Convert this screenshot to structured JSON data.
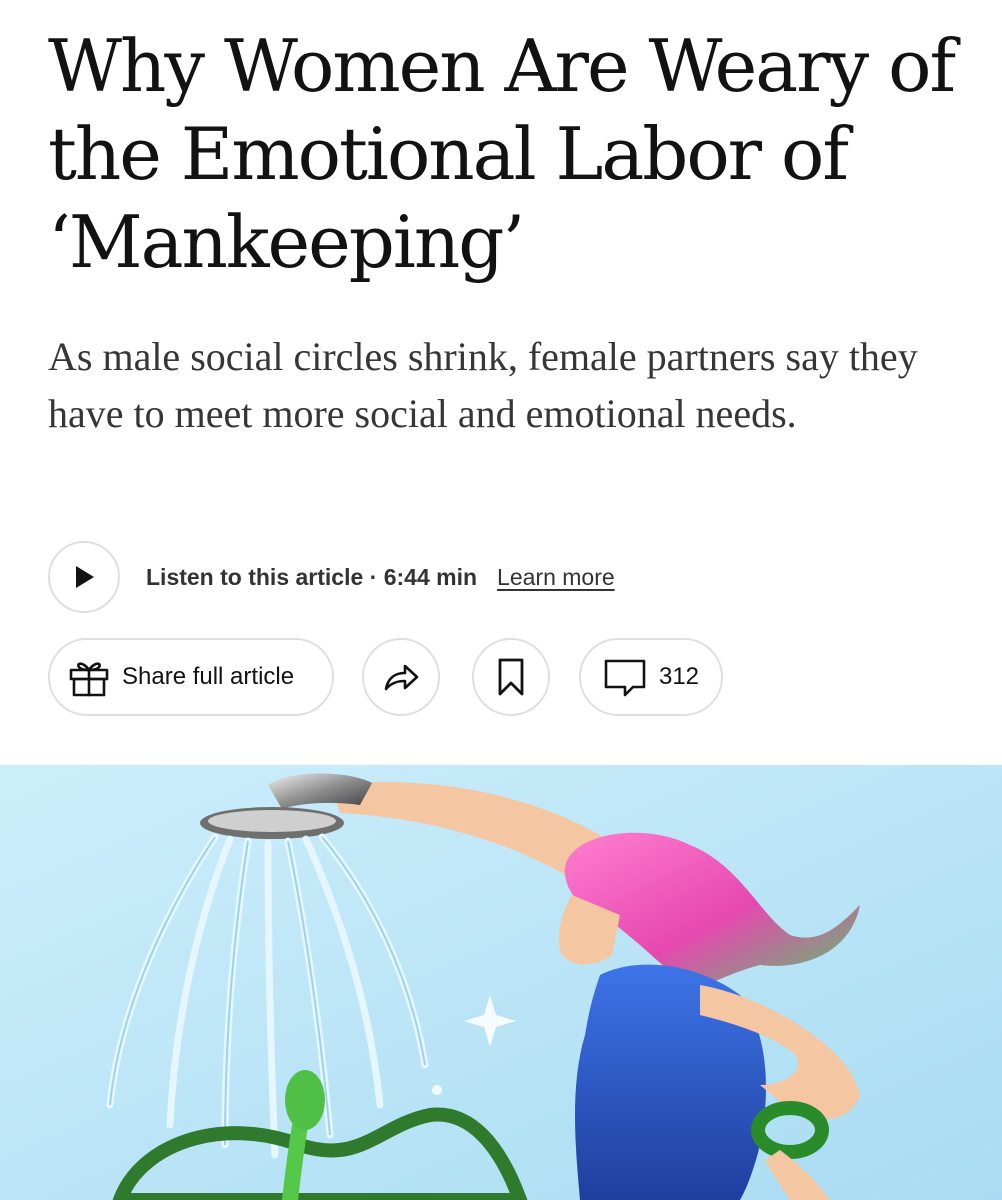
{
  "article": {
    "headline": "Why Women Are Weary of the Emotional Labor of ‘Mankeeping’",
    "summary": "As male social circles shrink, female partners say they have to meet more social and emotional needs."
  },
  "audio": {
    "listen_label": "Listen to this article · 6:44 min",
    "learn_more": "Learn more"
  },
  "actions": {
    "share_label": "Share full article",
    "comment_count": "312"
  },
  "icons": {
    "play": "play-icon",
    "gift": "gift-icon",
    "share_arrow": "share-arrow-icon",
    "bookmark": "bookmark-icon",
    "comment": "comment-bubble-icon"
  },
  "colors": {
    "text": "#121212",
    "summary_text": "#363636",
    "pill_border": "#dfdfdf",
    "illustration_sky": "#bfe6f7",
    "hair": "#f25fb8",
    "dress": "#2f63d6",
    "leaves": "#3fae3f"
  }
}
